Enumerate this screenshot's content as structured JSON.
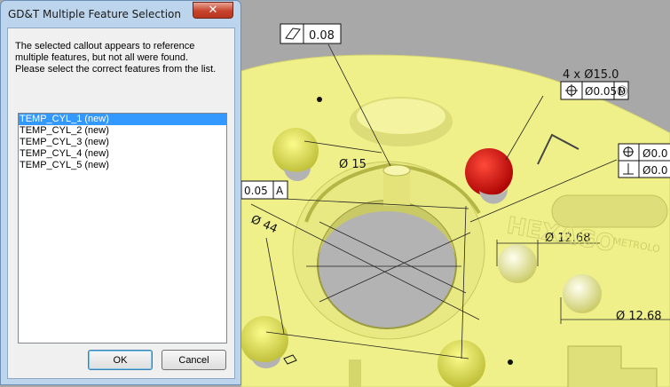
{
  "dialog": {
    "title": "GD&T Multiple Feature Selection",
    "close_icon": "close-icon",
    "message_lines": [
      "The selected callout appears to reference",
      "multiple features, but not all were found.",
      "Please select the correct features from the list."
    ],
    "features": [
      {
        "label": "TEMP_CYL_1 (new)",
        "selected": true
      },
      {
        "label": "TEMP_CYL_2 (new)",
        "selected": false
      },
      {
        "label": "TEMP_CYL_3 (new)",
        "selected": false
      },
      {
        "label": "TEMP_CYL_4 (new)",
        "selected": false
      },
      {
        "label": "TEMP_CYL_5 (new)",
        "selected": false
      }
    ],
    "ok_label": "OK",
    "cancel_label": "Cancel"
  },
  "viewport": {
    "colors": {
      "background": "#a8a8a8",
      "part": "#f0f08a",
      "hole": "#b3b3b3",
      "selected_feature": "#d40000"
    },
    "callouts": {
      "flatness_value": "0.08",
      "hole_pattern_label": "4 x Ø15.0",
      "position_tolerance": "Ø0.05Ⓜ",
      "position_datum": "D",
      "right_callout_1": "Ø0.0",
      "right_callout_2": "Ø0.0",
      "left_tolerance": "0.05",
      "left_datum": "A",
      "dim_small_bore": "Ø 15",
      "dim_large_bore": "Ø 44",
      "dim_boss_1": "Ø 12.68",
      "dim_boss_2": "Ø 12.68",
      "engraving": "HEXAGO",
      "engraving_sub": "METROLO"
    }
  }
}
